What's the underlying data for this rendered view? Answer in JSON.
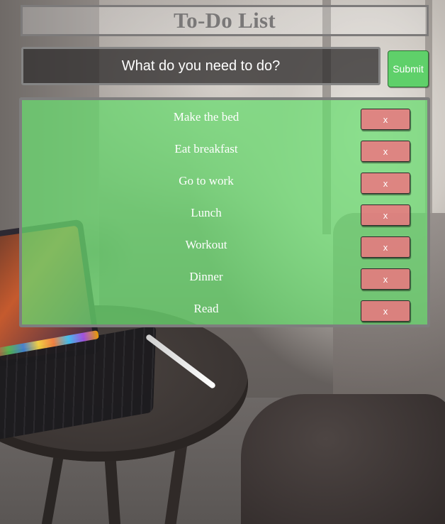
{
  "header": {
    "title": "To-Do List"
  },
  "new_todo": {
    "placeholder": "What do you need to do?",
    "value": ""
  },
  "actions": {
    "submit_label": "Submit"
  },
  "todos": [
    {
      "text": "Make the bed",
      "delete_label": "x"
    },
    {
      "text": "Eat breakfast",
      "delete_label": "x"
    },
    {
      "text": "Go to work",
      "delete_label": "x"
    },
    {
      "text": "Lunch",
      "delete_label": "x"
    },
    {
      "text": "Workout",
      "delete_label": "x"
    },
    {
      "text": "Dinner",
      "delete_label": "x"
    },
    {
      "text": "Read",
      "delete_label": "x"
    }
  ],
  "colors": {
    "panel_green": "#6bdc70",
    "submit_green": "#5fd06a",
    "delete_red": "#ec7680",
    "border_gray": "#7e7e7e",
    "input_dark": "#323030"
  }
}
